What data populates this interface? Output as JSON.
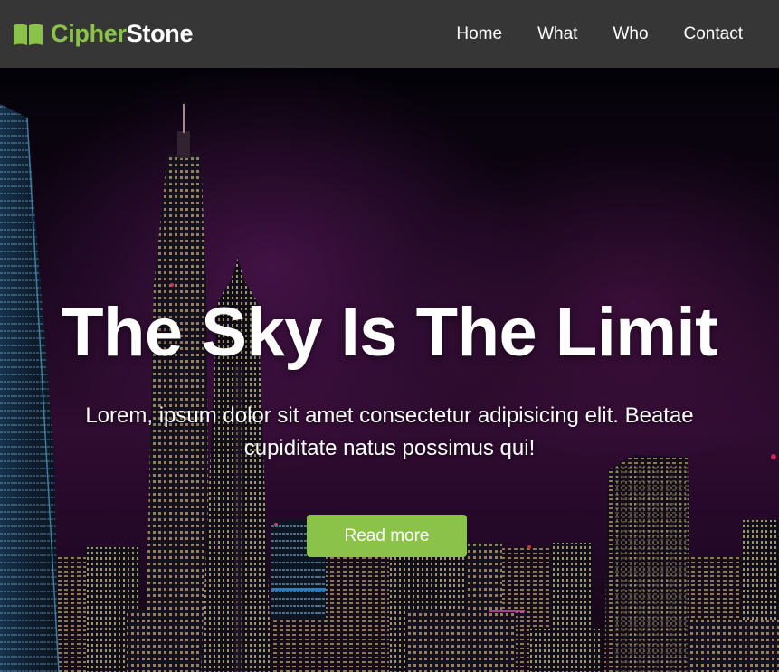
{
  "brand": {
    "icon": "open-book-icon",
    "name_part1": "Cipher",
    "name_part2": "Stone"
  },
  "nav": {
    "items": [
      {
        "label": "Home"
      },
      {
        "label": "What"
      },
      {
        "label": "Who"
      },
      {
        "label": "Contact"
      }
    ]
  },
  "hero": {
    "title": "The Sky Is The Limit",
    "text": "Lorem, ipsum dolor sit amet consectetur adipisicing elit. Beatae cupiditate natus possimus qui!",
    "button_label": "Read more",
    "background_image": "night-city-skyline"
  },
  "colors": {
    "navbar_bg": "#363636",
    "accent": "#8bc34a",
    "text": "#ffffff"
  }
}
